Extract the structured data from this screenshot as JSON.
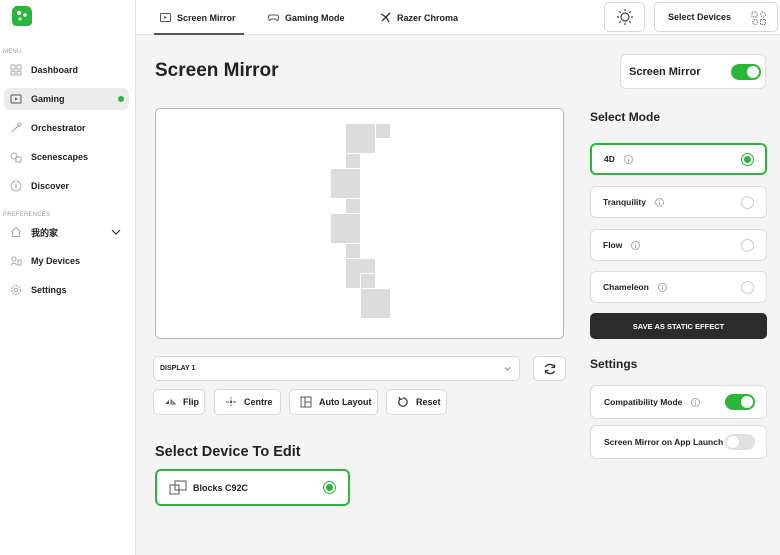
{
  "sidebar": {
    "menu_label": "MENU",
    "preferences_label": "PREFERENCES",
    "items": [
      {
        "label": "Dashboard"
      },
      {
        "label": "Gaming"
      },
      {
        "label": "Orchestrator"
      },
      {
        "label": "Scenescapes"
      },
      {
        "label": "Discover"
      }
    ],
    "pref_items": [
      {
        "label": "我的家"
      },
      {
        "label": "My Devices"
      },
      {
        "label": "Settings"
      }
    ]
  },
  "topbar": {
    "tabs": [
      {
        "label": "Screen Mirror",
        "icon": "screen-icon"
      },
      {
        "label": "Gaming Mode",
        "icon": "gamepad-icon"
      },
      {
        "label": "Razer Chroma",
        "icon": "razer-icon"
      }
    ],
    "select_devices_label": "Select Devices"
  },
  "main": {
    "title": "Screen Mirror",
    "mirror_toggle_label": "Screen Mirror",
    "display_select": "DISPLAY 1",
    "actions": [
      {
        "label": "Flip"
      },
      {
        "label": "Centre"
      },
      {
        "label": "Auto Layout"
      },
      {
        "label": "Reset"
      }
    ],
    "device_section_title": "Select Device To Edit",
    "device_name": "Blocks C92C"
  },
  "right_panel": {
    "mode_title": "Select Mode",
    "modes": [
      {
        "label": "4D"
      },
      {
        "label": "Tranquility"
      },
      {
        "label": "Flow"
      },
      {
        "label": "Chameleon"
      }
    ],
    "static_button": "SAVE AS STATIC EFFECT",
    "settings_title": "Settings",
    "settings": [
      {
        "label": "Compatibility Mode"
      },
      {
        "label": "Screen Mirror on App Launch"
      }
    ]
  },
  "colors": {
    "accent": "#2ab53b",
    "dark_button": "#2b2b2b"
  }
}
